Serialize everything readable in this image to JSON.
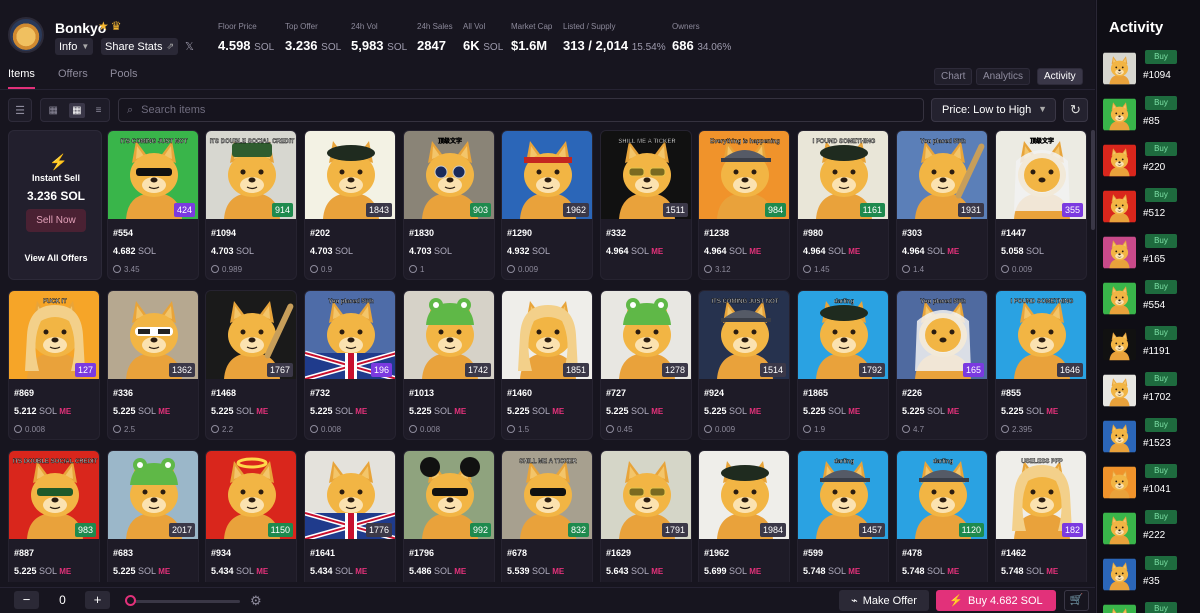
{
  "header": {
    "collection_name": "Bonkyo",
    "info_label": "Info",
    "share_label": "Share Stats",
    "stats": [
      {
        "label": "Floor Price",
        "value": "4.598",
        "unit": "SOL"
      },
      {
        "label": "Top Offer",
        "value": "3.236",
        "unit": "SOL"
      },
      {
        "label": "24h Vol",
        "value": "5,983",
        "unit": "SOL"
      },
      {
        "label": "24h Sales",
        "value": "2847",
        "unit": ""
      },
      {
        "label": "All Vol",
        "value": "6K",
        "unit": "SOL"
      },
      {
        "label": "Market Cap",
        "value": "$1.6M",
        "unit": ""
      },
      {
        "label": "Listed / Supply",
        "value": "313 / 2,014",
        "unit": "15.54%"
      },
      {
        "label": "Owners",
        "value": "686",
        "unit": "34.06%"
      }
    ]
  },
  "tabs": [
    "Items",
    "Offers",
    "Pools"
  ],
  "view_toggles": [
    "Chart",
    "Analytics",
    "Activity"
  ],
  "toolbar": {
    "search_placeholder": "Search items",
    "sort_label": "Price: Low to High"
  },
  "instant_sell": {
    "title": "Instant Sell",
    "price": "3.236 SOL",
    "button": "Sell Now",
    "view_all": "View All Offers"
  },
  "colors": {
    "accent": "#e2317a",
    "green": "#1e8a4e",
    "purple": "#7b3ae0"
  },
  "items": [
    {
      "id": "#554",
      "price": "4.682",
      "me": false,
      "fee": "3.45",
      "rank": "424",
      "rc": "purple",
      "bg": "#39b54a",
      "cap": "glasses-dark",
      "text": "ITS COMING JUST NOT"
    },
    {
      "id": "#1094",
      "price": "4.703",
      "me": false,
      "fee": "0.989",
      "rank": "914",
      "rc": "green",
      "bg": "#d7d7d0",
      "cap": "hat-green",
      "text": "ITS DOUBLE SOCIAL CREDIT"
    },
    {
      "id": "#202",
      "price": "4.703",
      "me": false,
      "fee": "0.9",
      "rank": "1843",
      "rc": "gray",
      "bg": "#f3f2e4",
      "cap": "beret",
      "text": ""
    },
    {
      "id": "#1830",
      "price": "4.703",
      "me": false,
      "fee": "1",
      "rank": "903",
      "rc": "green",
      "bg": "#8a8477",
      "cap": "glasses-round",
      "text": "顶级文字"
    },
    {
      "id": "#1290",
      "price": "4.932",
      "me": false,
      "fee": "0.009",
      "rank": "1962",
      "rc": "gray",
      "bg": "#2b66b8",
      "cap": "band-red",
      "text": ""
    },
    {
      "id": "#332",
      "price": "4.964",
      "me": true,
      "fee": "",
      "rank": "1511",
      "rc": "gray",
      "bg": "#111111",
      "cap": "glasses-gold",
      "text": "SHILL ME A TICKER"
    },
    {
      "id": "#1238",
      "price": "4.964",
      "me": true,
      "fee": "3.12",
      "rank": "984",
      "rc": "green",
      "bg": "#f0932b",
      "cap": "cap-gray",
      "text": "Everything is happening"
    },
    {
      "id": "#980",
      "price": "4.964",
      "me": true,
      "fee": "1.45",
      "rank": "1161",
      "rc": "green",
      "bg": "#e9e6d8",
      "cap": "beret",
      "text": "I FOUND SOMETHING"
    },
    {
      "id": "#303",
      "price": "4.964",
      "me": true,
      "fee": "1.4",
      "rank": "1931",
      "rc": "gray",
      "bg": "#5b7fb8",
      "cap": "bat",
      "text": "You placed 56th"
    },
    {
      "id": "#1447",
      "price": "5.058",
      "me": false,
      "fee": "0.009",
      "rank": "355",
      "rc": "purple",
      "bg": "#ecebe3",
      "cap": "keffiyeh",
      "text": "顶级文字"
    },
    {
      "id": "#869",
      "price": "5.212",
      "me": true,
      "fee": "0.008",
      "rank": "127",
      "rc": "purple",
      "bg": "#f6a528",
      "cap": "hair-blonde",
      "text": "FUCK IT"
    },
    {
      "id": "#336",
      "price": "5.225",
      "me": true,
      "fee": "2.5",
      "rank": "1362",
      "rc": "gray",
      "bg": "#b6a890",
      "cap": "glasses-white",
      "text": ""
    },
    {
      "id": "#1468",
      "price": "5.225",
      "me": true,
      "fee": "2.2",
      "rank": "1767",
      "rc": "gray",
      "bg": "#1a1a1a",
      "cap": "bat",
      "text": ""
    },
    {
      "id": "#732",
      "price": "5.225",
      "me": true,
      "fee": "0.008",
      "rank": "196",
      "rc": "purple",
      "bg": "#4e6ca8",
      "cap": "flag",
      "text": "You placed 56th"
    },
    {
      "id": "#1013",
      "price": "5.225",
      "me": true,
      "fee": "0.008",
      "rank": "1742",
      "rc": "gray",
      "bg": "#d6d2c8",
      "cap": "frog",
      "text": ""
    },
    {
      "id": "#1460",
      "price": "5.225",
      "me": true,
      "fee": "1.5",
      "rank": "1851",
      "rc": "gray",
      "bg": "#efeeea",
      "cap": "hair-blonde",
      "text": ""
    },
    {
      "id": "#727",
      "price": "5.225",
      "me": true,
      "fee": "0.45",
      "rank": "1278",
      "rc": "gray",
      "bg": "#e8e7e2",
      "cap": "frog",
      "text": ""
    },
    {
      "id": "#924",
      "price": "5.225",
      "me": true,
      "fee": "0.009",
      "rank": "1514",
      "rc": "gray",
      "bg": "#26324e",
      "cap": "cap-gray",
      "text": "ITS COMING JUST NOT"
    },
    {
      "id": "#1865",
      "price": "5.225",
      "me": true,
      "fee": "1.9",
      "rank": "1792",
      "rc": "gray",
      "bg": "#2aa2e2",
      "cap": "beret",
      "text": "darling"
    },
    {
      "id": "#226",
      "price": "5.225",
      "me": true,
      "fee": "4.7",
      "rank": "165",
      "rc": "purple",
      "bg": "#4f6aa0",
      "cap": "keffiyeh",
      "text": "You placed 56th"
    },
    {
      "id": "#855",
      "price": "5.225",
      "me": true,
      "fee": "2.395",
      "rank": "1646",
      "rc": "gray",
      "bg": "#2aa2e2",
      "cap": "none",
      "text": "I FOUND SOMETHING"
    },
    {
      "id": "#887",
      "price": "5.225",
      "me": true,
      "fee": "",
      "rank": "983",
      "rc": "green",
      "bg": "#d9261c",
      "cap": "glasses-green",
      "text": "ITS DOUBLE SOCIAL CREDIT"
    },
    {
      "id": "#683",
      "price": "5.225",
      "me": true,
      "fee": "",
      "rank": "2017",
      "rc": "gray",
      "bg": "#9bb7c9",
      "cap": "frog",
      "text": ""
    },
    {
      "id": "#934",
      "price": "5.434",
      "me": true,
      "fee": "",
      "rank": "1150",
      "rc": "green",
      "bg": "#d9261c",
      "cap": "halo",
      "text": ""
    },
    {
      "id": "#1641",
      "price": "5.434",
      "me": true,
      "fee": "",
      "rank": "1776",
      "rc": "gray",
      "bg": "#e4e2dc",
      "cap": "flag",
      "text": ""
    },
    {
      "id": "#1796",
      "price": "5.486",
      "me": true,
      "fee": "",
      "rank": "992",
      "rc": "green",
      "bg": "#8fa37e",
      "cap": "mouse-ears",
      "text": ""
    },
    {
      "id": "#678",
      "price": "5.539",
      "me": true,
      "fee": "",
      "rank": "832",
      "rc": "green",
      "bg": "#a7a08f",
      "cap": "glasses-dark",
      "text": "SHILL ME A TICKER"
    },
    {
      "id": "#1629",
      "price": "5.643",
      "me": true,
      "fee": "",
      "rank": "1791",
      "rc": "gray",
      "bg": "#d5d6c8",
      "cap": "glasses-gold",
      "text": ""
    },
    {
      "id": "#1962",
      "price": "5.699",
      "me": true,
      "fee": "",
      "rank": "1984",
      "rc": "gray",
      "bg": "#efeeea",
      "cap": "beret",
      "text": ""
    },
    {
      "id": "#599",
      "price": "5.748",
      "me": true,
      "fee": "",
      "rank": "1457",
      "rc": "gray",
      "bg": "#2aa2e2",
      "cap": "cap-gray",
      "text": "darling"
    },
    {
      "id": "#478",
      "price": "5.748",
      "me": true,
      "fee": "",
      "rank": "1120",
      "rc": "green",
      "bg": "#2aa2e2",
      "cap": "cap-gray",
      "text": "darling"
    },
    {
      "id": "#1462",
      "price": "5.748",
      "me": true,
      "fee": "",
      "rank": "182",
      "rc": "purple",
      "bg": "#efeeea",
      "cap": "hair-blonde",
      "text": "USELESS PFP"
    }
  ],
  "activity": {
    "title": "Activity",
    "badge": "Buy",
    "items": [
      {
        "id": "#1094",
        "bg": "#d7d7d0"
      },
      {
        "id": "#85",
        "bg": "#39b54a"
      },
      {
        "id": "#220",
        "bg": "#d9261c"
      },
      {
        "id": "#512",
        "bg": "#d9261c"
      },
      {
        "id": "#165",
        "bg": "#c94a8a"
      },
      {
        "id": "#554",
        "bg": "#39b54a"
      },
      {
        "id": "#1191",
        "bg": "#111111"
      },
      {
        "id": "#1702",
        "bg": "#e8e7e2"
      },
      {
        "id": "#1523",
        "bg": "#2b66b8"
      },
      {
        "id": "#1041",
        "bg": "#f0932b"
      },
      {
        "id": "#222",
        "bg": "#39b54a"
      },
      {
        "id": "#35",
        "bg": "#2b66b8"
      },
      {
        "id": "",
        "bg": "#39b54a"
      }
    ]
  },
  "bottom": {
    "qty": "0",
    "make_offer": "Make Offer",
    "buy_label": "Buy 4.682 SOL"
  }
}
